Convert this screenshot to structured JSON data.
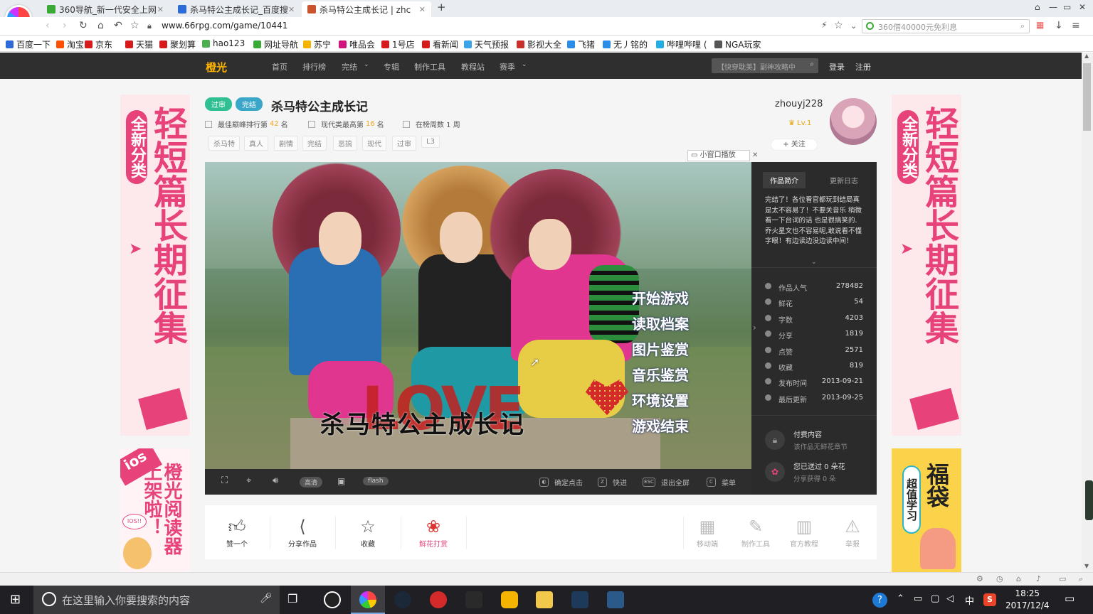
{
  "browser": {
    "tabs": [
      {
        "label": "360导航_新一代安全上网",
        "active": false,
        "icon_color": "#3aa935"
      },
      {
        "label": "杀马特公主成长记_百度搜",
        "active": false,
        "icon_color": "#2e6bd6"
      },
      {
        "label": "杀马特公主成长记 | zhc",
        "active": true,
        "icon_color": "#c9542d"
      }
    ],
    "url": "www.66rpg.com/game/10441",
    "search_placeholder": "360借40000元免利息",
    "bookmarks": [
      {
        "label": "百度一下",
        "color": "#2e6bd6"
      },
      {
        "label": "淘宝",
        "color": "#ff5000"
      },
      {
        "label": "京东",
        "color": "#d71a1b"
      },
      {
        "label": "天猫",
        "color": "#d71a1b"
      },
      {
        "label": "聚划算",
        "color": "#d71a1b"
      },
      {
        "label": "hao123",
        "color": "#4caf50"
      },
      {
        "label": "网址导航",
        "color": "#3aa935"
      },
      {
        "label": "苏宁",
        "color": "#f5b400"
      },
      {
        "label": "唯品会",
        "color": "#d1137e"
      },
      {
        "label": "1号店",
        "color": "#d71a1b"
      },
      {
        "label": "看新闻",
        "color": "#d71a1b"
      },
      {
        "label": "天气预报",
        "color": "#3ba3e8"
      },
      {
        "label": "影视大全",
        "color": "#c9302c"
      },
      {
        "label": "飞猪",
        "color": "#2a8ee8"
      },
      {
        "label": "无丿铭的",
        "color": "#2a8ee8"
      },
      {
        "label": "哔哩哔哩 (",
        "color": "#23ade5"
      },
      {
        "label": "NGA玩家",
        "color": "#555555"
      }
    ]
  },
  "site": {
    "logo": "橙光",
    "nav": [
      "首页",
      "排行榜",
      "完结",
      "专辑",
      "制作工具",
      "教程站",
      "赛季"
    ],
    "search_placeholder": "【快穿耽美】副神攻略中",
    "login": "登录",
    "register": "注册"
  },
  "game": {
    "badges": [
      {
        "label": "过审",
        "color": "#2fbf93"
      },
      {
        "label": "完结",
        "color": "#3aa7c9"
      }
    ],
    "title": "杀马特公主成长记",
    "stat_best_rank_prefix": "最佳巅峰排行第",
    "stat_best_rank_value": "42",
    "stat_modern_prefix": "现代类最高第",
    "stat_modern_value": "16",
    "stat_rank_suffix": "名",
    "stat_weeks": "在榜周数 1 周",
    "tags": [
      "杀马特",
      "真人",
      "剧情",
      "完结",
      "恶搞",
      "现代",
      "过审",
      "L3"
    ],
    "author": "zhouyj228",
    "level": "Lv.1",
    "follow": "+ 关注",
    "popout": "小窗口播放",
    "menu": [
      "开始游戏",
      "读取档案",
      "图片鉴赏",
      "音乐鉴赏",
      "环境设置",
      "游戏结束"
    ],
    "logo_text": "杀马特公主成长记",
    "love_text": "LOVE",
    "controls": {
      "quality": "高清",
      "mode": "flash",
      "confirm": "确定点击",
      "fast": "快进",
      "exit_full": "退出全屏",
      "menu": "菜单"
    }
  },
  "panel": {
    "tab_intro": "作品简介",
    "tab_log": "更新日志",
    "intro": "完结了！各位看官都玩到结局真是太不容易了！不要关音乐 稍微看一下台词的话 也是很搞笑的.\n乔火星文也不容易呢,敢说看不懂字眼！有边读边没边读中间！",
    "stats": [
      {
        "label": "作品人气",
        "value": "278482"
      },
      {
        "label": "鲜花",
        "value": "54"
      },
      {
        "label": "字数",
        "value": "4203"
      },
      {
        "label": "分享",
        "value": "1819"
      },
      {
        "label": "点赞",
        "value": "2571"
      },
      {
        "label": "收藏",
        "value": "819"
      },
      {
        "label": "发布时间",
        "value": "2013-09-21"
      },
      {
        "label": "最后更新",
        "value": "2013-09-25"
      }
    ],
    "paid_title": "付费内容",
    "paid_sub": "该作品无鲜花章节",
    "sent_title": "您已送过 0 朵花",
    "sent_sub": "分享获得 0 朵"
  },
  "actions": {
    "like": "赞一个",
    "share": "分享作品",
    "fav": "收藏",
    "flower": "鲜花打赏",
    "mobile": "移动端",
    "tool": "制作工具",
    "tutorial": "官方教程",
    "report": "举报"
  },
  "ads": {
    "left_top_small": "全新分类",
    "left_top_big": "轻短篇长期征集",
    "right_top_small": "全新分类",
    "right_top_big": "轻短篇长期征集",
    "left_bottom_ios": "ios",
    "left_bottom_text": "橙光阅读器上架啦！",
    "left_bottom_bubble": "IOS!!",
    "right_bottom_small": "超值学习",
    "right_bottom_big": "福袋"
  },
  "taskbar": {
    "search_placeholder": "在这里输入你要搜索的内容",
    "time": "18:25",
    "date": "2017/12/4",
    "ime": "中"
  }
}
